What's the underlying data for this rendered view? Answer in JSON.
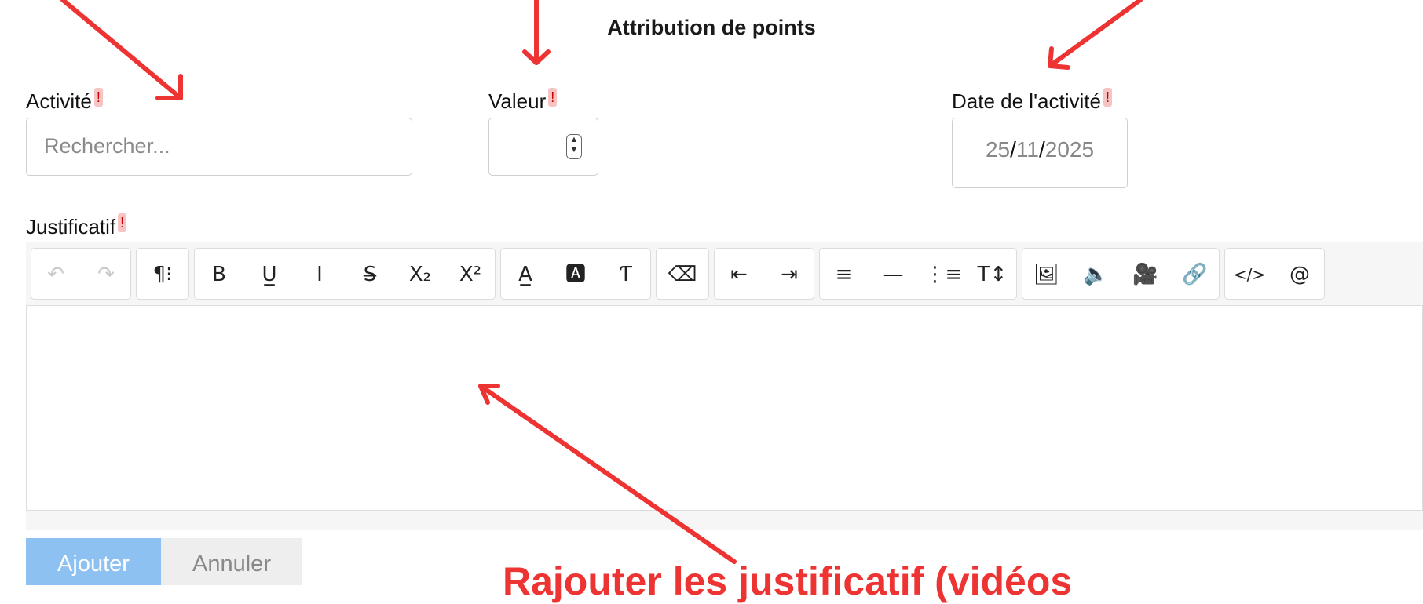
{
  "form": {
    "title": "Attribution de points",
    "activity": {
      "label": "Activité",
      "required_mark": "!",
      "placeholder": "Rechercher..."
    },
    "value": {
      "label": "Valeur",
      "required_mark": "!"
    },
    "date": {
      "label": "Date de l'activité",
      "required_mark": "!",
      "day": "25",
      "month": "11",
      "year": "2025",
      "separator": "/"
    },
    "justification": {
      "label": "Justificatif",
      "required_mark": "!"
    }
  },
  "toolbar": {
    "groups": [
      {
        "buttons": [
          {
            "name": "undo-icon",
            "glyph": "↶",
            "disabled": true
          },
          {
            "name": "redo-icon",
            "glyph": "↷",
            "disabled": true
          }
        ]
      },
      {
        "buttons": [
          {
            "name": "paragraph-format-icon",
            "glyph": "¶⁝"
          }
        ]
      },
      {
        "buttons": [
          {
            "name": "bold-icon",
            "glyph": "B"
          },
          {
            "name": "underline-icon",
            "glyph": "U̲"
          },
          {
            "name": "italic-icon",
            "glyph": "I"
          },
          {
            "name": "strikethrough-icon",
            "glyph": "S̶"
          },
          {
            "name": "subscript-icon",
            "glyph": "X₂"
          },
          {
            "name": "superscript-icon",
            "glyph": "X²"
          }
        ]
      },
      {
        "buttons": [
          {
            "name": "text-color-icon",
            "glyph": "A̲"
          },
          {
            "name": "background-color-icon",
            "glyph": "🅰"
          },
          {
            "name": "text-style-icon",
            "glyph": "Ƭ"
          }
        ]
      },
      {
        "buttons": [
          {
            "name": "clear-formatting-icon",
            "glyph": "⌫"
          }
        ]
      },
      {
        "buttons": [
          {
            "name": "outdent-icon",
            "glyph": "⇤"
          },
          {
            "name": "indent-icon",
            "glyph": "⇥"
          }
        ]
      },
      {
        "buttons": [
          {
            "name": "align-left-icon",
            "glyph": "≡"
          },
          {
            "name": "horizontal-rule-icon",
            "glyph": "—"
          },
          {
            "name": "ordered-list-icon",
            "glyph": "⋮≡"
          },
          {
            "name": "line-height-icon",
            "glyph": "T↕"
          }
        ]
      },
      {
        "buttons": [
          {
            "name": "image-icon",
            "glyph": "🖼"
          },
          {
            "name": "audio-icon",
            "glyph": "🔈"
          },
          {
            "name": "video-icon",
            "glyph": "🎥"
          },
          {
            "name": "link-icon",
            "glyph": "🔗"
          }
        ]
      },
      {
        "buttons": [
          {
            "name": "code-view-icon",
            "glyph": "</>"
          },
          {
            "name": "mention-icon",
            "glyph": "@"
          }
        ]
      }
    ]
  },
  "actions": {
    "submit_label": "Ajouter",
    "cancel_label": "Annuler"
  },
  "annotation": {
    "text": "Rajouter les justificatif (vidéos"
  },
  "colors": {
    "accent": "#8cc1f2",
    "annotation": "#ee3333",
    "required_badge": "#f7c4c4"
  }
}
